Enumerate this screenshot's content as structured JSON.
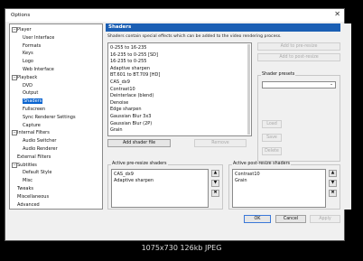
{
  "window": {
    "title": "Options",
    "close_glyph": "✕"
  },
  "tree": {
    "items": [
      {
        "label": "Player",
        "indent": 0,
        "box": "−"
      },
      {
        "label": "User Interface",
        "indent": 1
      },
      {
        "label": "Formats",
        "indent": 1
      },
      {
        "label": "Keys",
        "indent": 1
      },
      {
        "label": "Logo",
        "indent": 1
      },
      {
        "label": "Web Interface",
        "indent": 1
      },
      {
        "label": "Playback",
        "indent": 0,
        "box": "−"
      },
      {
        "label": "DVD",
        "indent": 1
      },
      {
        "label": "Output",
        "indent": 1
      },
      {
        "label": "Shaders",
        "indent": 1,
        "selected": true
      },
      {
        "label": "Fullscreen",
        "indent": 1
      },
      {
        "label": "Sync Renderer Settings",
        "indent": 1
      },
      {
        "label": "Capture",
        "indent": 1
      },
      {
        "label": "Internal Filters",
        "indent": 0,
        "box": "−"
      },
      {
        "label": "Audio Switcher",
        "indent": 1
      },
      {
        "label": "Audio Renderer",
        "indent": 1
      },
      {
        "label": "External Filters",
        "indent": 0
      },
      {
        "label": "Subtitles",
        "indent": 0,
        "box": "−"
      },
      {
        "label": "Default Style",
        "indent": 1
      },
      {
        "label": "Misc",
        "indent": 1
      },
      {
        "label": "Tweaks",
        "indent": 0
      },
      {
        "label": "Miscellaneous",
        "indent": 0
      },
      {
        "label": "Advanced",
        "indent": 0
      }
    ]
  },
  "shaders": {
    "header": "Shaders",
    "description": "Shaders contain special effects which can be added to the video rendering process.",
    "list": [
      "0-255 to 16-235",
      "16-235 to 0-255 [SD]",
      "16-235 to 0-255",
      "Adaptive sharpen",
      "BT.601 to BT.709 [HD]",
      "CAS_dx9",
      "Contrast10",
      "Deinterlace (blend)",
      "Denoise",
      "Edge sharpen",
      "Gaussian Blur 3x3",
      "Gaussian Blur (2P)",
      "Grain"
    ],
    "add_button": "Add shader file",
    "remove_button": "Remove",
    "add_pre_button": "Add to pre-resize",
    "add_post_button": "Add to post-resize",
    "presets_label": "Shader presets",
    "load_button": "Load",
    "save_button": "Save",
    "delete_button": "Delete",
    "pre_label": "Active pre-resize shaders",
    "pre_list": [
      "CAS_dx9",
      "Adaptive sharpen"
    ],
    "post_label": "Active post-resize shaders",
    "post_list": [
      "Contrast10",
      "Grain"
    ],
    "up_glyph": "▲",
    "down_glyph": "▼",
    "del_glyph": "✖"
  },
  "footer": {
    "ok": "OK",
    "cancel": "Cancel",
    "apply": "Apply"
  },
  "caption": "1075x730 126kb JPEG"
}
